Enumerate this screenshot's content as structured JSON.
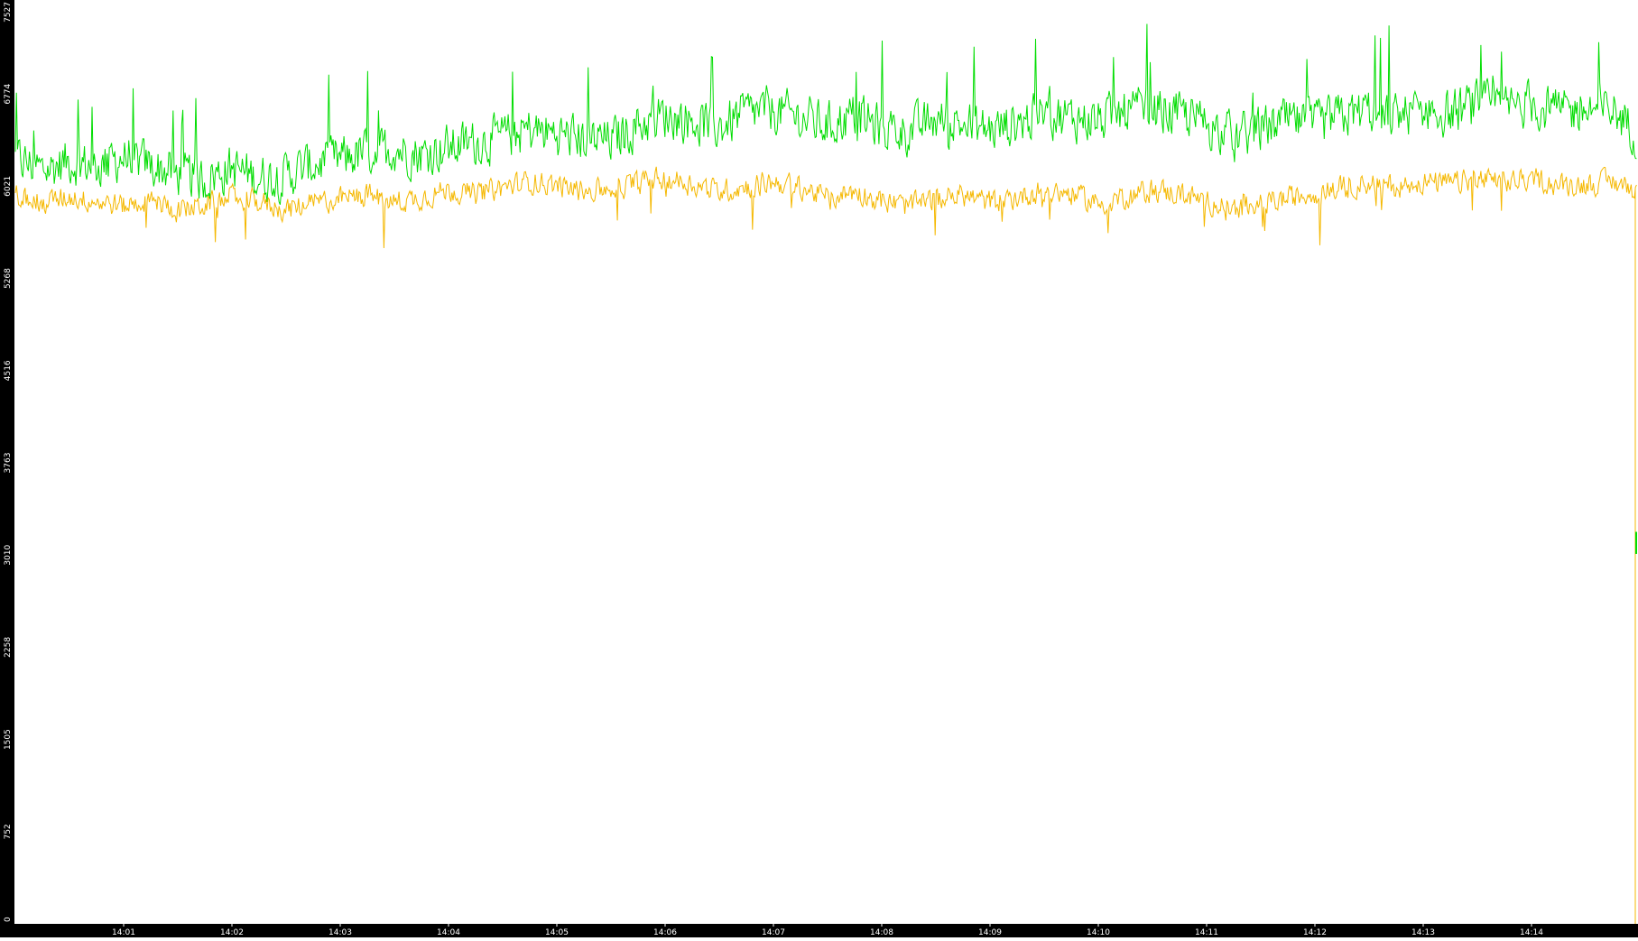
{
  "chart_data": {
    "type": "line",
    "title": "",
    "xlabel": "",
    "ylabel": "",
    "ylim": [
      0,
      7527
    ],
    "y_ticks": [
      "0",
      "752",
      "1505",
      "2258",
      "3010",
      "3763",
      "4516",
      "5268",
      "6021",
      "6774",
      "7527"
    ],
    "x_ticks": [
      "14:01",
      "14:02",
      "14:03",
      "14:04",
      "14:05",
      "14:06",
      "14:07",
      "14:08",
      "14:09",
      "14:10",
      "14:11",
      "14:12",
      "14:13",
      "14:14"
    ],
    "x_tick_minutes": [
      1,
      2,
      3,
      4,
      5,
      6,
      7,
      8,
      9,
      10,
      11,
      12,
      13,
      14
    ],
    "x_range_minutes": [
      0.0,
      14.97
    ],
    "grid": false,
    "legend": "none",
    "colors": {
      "background": "#ffffff",
      "axis_band": "#000000",
      "axis_text": "#ffffff",
      "green_series": "#00dd00",
      "orange_series": "#f5b800"
    },
    "series": [
      {
        "color": "#00dd00",
        "x_minutes": [
          0.0,
          0.25,
          0.5,
          0.75,
          1.0,
          1.25,
          1.5,
          1.75,
          2.0,
          2.25,
          2.5,
          2.75,
          3.0,
          3.25,
          3.5,
          3.75,
          4.0,
          4.25,
          4.5,
          4.75,
          5.0,
          5.25,
          5.5,
          5.75,
          6.0,
          6.25,
          6.5,
          6.75,
          7.0,
          7.25,
          7.5,
          7.75,
          8.0,
          8.25,
          8.5,
          8.75,
          9.0,
          9.25,
          9.5,
          9.75,
          10.0,
          10.25,
          10.5,
          10.75,
          11.0,
          11.25,
          11.5,
          11.75,
          12.0,
          12.25,
          12.5,
          12.75,
          13.0,
          13.25,
          13.5,
          13.75,
          14.0,
          14.25,
          14.5,
          14.75,
          14.95
        ],
        "values": [
          6250,
          6150,
          6230,
          6180,
          6260,
          6190,
          6120,
          6080,
          6170,
          6090,
          6110,
          6200,
          6240,
          6300,
          6330,
          6280,
          6340,
          6380,
          6420,
          6480,
          6450,
          6410,
          6390,
          6520,
          6600,
          6560,
          6500,
          6620,
          6640,
          6580,
          6520,
          6600,
          6500,
          6470,
          6560,
          6530,
          6480,
          6540,
          6610,
          6580,
          6560,
          6620,
          6660,
          6600,
          6540,
          6420,
          6480,
          6550,
          6510,
          6590,
          6640,
          6600,
          6650,
          6610,
          6690,
          6660,
          6700,
          6620,
          6640,
          6650,
          6480
        ]
      },
      {
        "color": "#f5b800",
        "x_minutes": [
          0.0,
          0.25,
          0.5,
          0.75,
          1.0,
          1.25,
          1.5,
          1.75,
          2.0,
          2.25,
          2.5,
          2.75,
          3.0,
          3.25,
          3.5,
          3.75,
          4.0,
          4.25,
          4.5,
          4.75,
          5.0,
          5.25,
          5.5,
          5.75,
          6.0,
          6.25,
          6.5,
          6.75,
          7.0,
          7.25,
          7.5,
          7.75,
          8.0,
          8.25,
          8.5,
          8.75,
          9.0,
          9.25,
          9.5,
          9.75,
          10.0,
          10.25,
          10.5,
          10.75,
          11.0,
          11.25,
          11.5,
          11.75,
          12.0,
          12.25,
          12.5,
          12.75,
          13.0,
          13.25,
          13.5,
          13.75,
          14.0,
          14.25,
          14.5,
          14.75,
          14.95
        ],
        "values": [
          5960,
          5880,
          5940,
          5900,
          5860,
          5910,
          5820,
          5870,
          5930,
          5890,
          5830,
          5880,
          5920,
          5950,
          5890,
          5930,
          5990,
          5960,
          6010,
          6060,
          6030,
          5980,
          6000,
          6050,
          6090,
          6040,
          5980,
          6020,
          6060,
          6010,
          5930,
          5980,
          5900,
          5860,
          5920,
          5950,
          5890,
          5930,
          5990,
          5960,
          5880,
          5940,
          5990,
          5960,
          5900,
          5840,
          5880,
          5920,
          5970,
          6010,
          6050,
          6020,
          6060,
          6040,
          6080,
          6050,
          6090,
          6030,
          6040,
          6060,
          6000
        ]
      }
    ]
  }
}
